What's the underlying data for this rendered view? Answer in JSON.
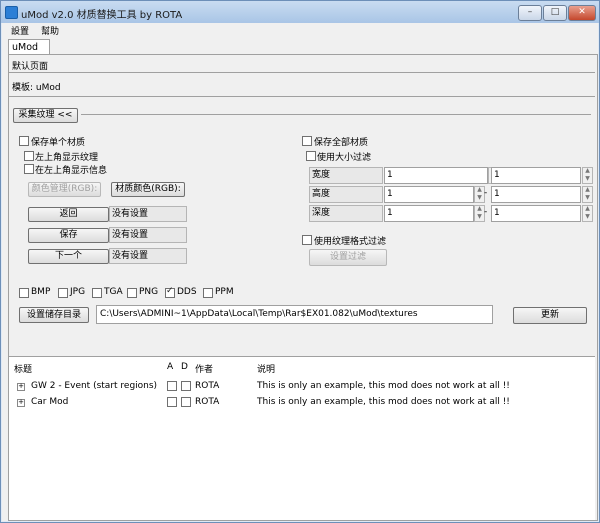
{
  "window": {
    "title": "uMod v2.0 材质替换工具 by ROTA",
    "min": "–",
    "max": "□",
    "close": "✕"
  },
  "menu": [
    "設置",
    "幫助"
  ],
  "tab": "uMod",
  "default_page": "默认页面",
  "template_label": "模板: uMod",
  "collect_section": {
    "button": "采集纹理 <<"
  },
  "left": {
    "save_single": "保存单个材质",
    "show_string": "左上角显示纹理",
    "show_info": "在左上角显示信息",
    "color_mgmt": "颜色管理(RGB):",
    "material_color": "材质颜色(RGB):",
    "buttons": [
      {
        "label": "返回",
        "desc": "没有设置"
      },
      {
        "label": "保存",
        "desc": "没有设置"
      },
      {
        "label": "下一个",
        "desc": "没有设置"
      }
    ]
  },
  "right": {
    "save_all": "保存全部材质",
    "use_size_filter": "使用大小过滤",
    "rows": [
      {
        "label": "宽度",
        "min": "1",
        "max": "1"
      },
      {
        "label": "高度",
        "min": "1",
        "max": "1"
      },
      {
        "label": "深度",
        "min": "1",
        "max": "1"
      }
    ],
    "dash": "-",
    "use_format_filter": "使用纹理格式过滤",
    "set_filter": "设置过滤"
  },
  "formats": [
    {
      "name": "BMP",
      "checked": false
    },
    {
      "name": "JPG",
      "checked": false
    },
    {
      "name": "TGA",
      "checked": false
    },
    {
      "name": "PNG",
      "checked": false
    },
    {
      "name": "DDS",
      "checked": true
    },
    {
      "name": "PPM",
      "checked": false
    }
  ],
  "save_path": {
    "button": "设置储存目录",
    "value": "C:\\Users\\ADMINI~1\\AppData\\Local\\Temp\\Rar$EX01.082\\uMod\\textures"
  },
  "update_button": "更新",
  "table": {
    "headers": {
      "title": "标题",
      "a": "A",
      "d": "D",
      "author": "作者",
      "desc": "说明"
    },
    "rows": [
      {
        "title": "GW 2 - Event  (start regions)",
        "author": "ROTA",
        "desc": "This is only an example, this mod does not work at all !!"
      },
      {
        "title": "Car Mod",
        "author": "ROTA",
        "desc": "This is only an example, this mod does not work at all !!"
      }
    ]
  },
  "colors": {
    "titlebar": "#b7cfeb",
    "accent": "#2c7fd6"
  }
}
